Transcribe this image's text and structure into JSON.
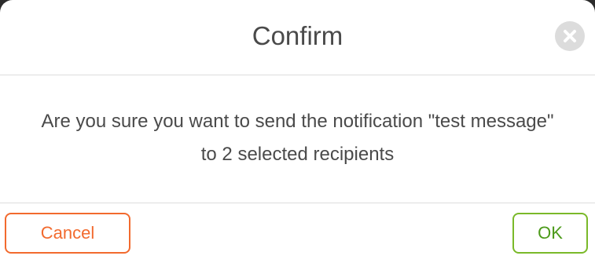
{
  "dialog": {
    "title": "Confirm",
    "close_icon": "close-icon",
    "message": "Are you sure you want to send the notification \"test message\" to 2 selected recipients",
    "cancel_label": "Cancel",
    "ok_label": "OK"
  },
  "colors": {
    "cancel_accent": "#f26a2e",
    "ok_accent": "#7ab929",
    "text": "#4a4a4a",
    "divider": "#dcdcdc"
  }
}
